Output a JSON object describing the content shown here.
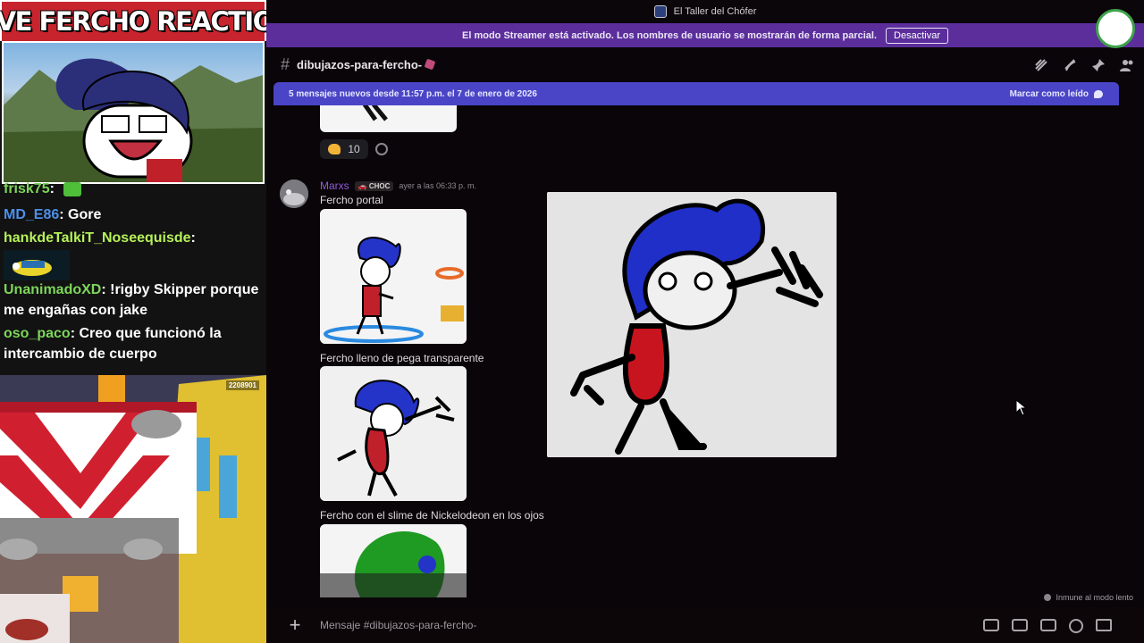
{
  "overlay": {
    "title": "LIVE FERCHO REACTION",
    "chat": [
      {
        "user": "frisk75",
        "sep": ":",
        "text": ""
      },
      {
        "user": "MD_E86",
        "sep": ":",
        "text": "Gore"
      },
      {
        "user": "hankdeTalkiT_Noseequisde",
        "sep": ":",
        "text": ""
      },
      {
        "user": "UnanimadoXD",
        "sep": ":",
        "text": "!rigby Skipper porque me engañas con jake"
      },
      {
        "user": "oso_paco",
        "sep": ":",
        "text": "Creo que funcionó la intercambio de cuerpo"
      }
    ],
    "game_score": "2208901"
  },
  "discord": {
    "window_title": "El Taller del Chófer",
    "streamer_notice": "El modo Streamer está activado. Los nombres de usuario se mostrarán de forma parcial.",
    "disable_label": "Desactivar",
    "channel_name": "dibujazos-para-fercho-",
    "new_messages": "5 mensajes nuevos desde 11:57 p.m. el 7 de enero de 2026",
    "mark_read": "Marcar como leído",
    "reaction_count": "10",
    "message": {
      "author": "Marxs",
      "badge": "CHOC",
      "timestamp": "ayer a las 06:33 p. m.",
      "captions": [
        "Fercho portal",
        "Fercho lleno de pega transparente",
        "Fercho con el slime de Nickelodeon en los ojos"
      ]
    },
    "slow_mode": "Inmune al modo lento",
    "composer_placeholder": "Mensaje #dibujazos-para-fercho-"
  },
  "colors": {
    "streamer_bar": "#5b2e9c",
    "new_messages_bar": "#4a45c6",
    "author": "#8e5bd8",
    "title_red": "#c8242d"
  }
}
